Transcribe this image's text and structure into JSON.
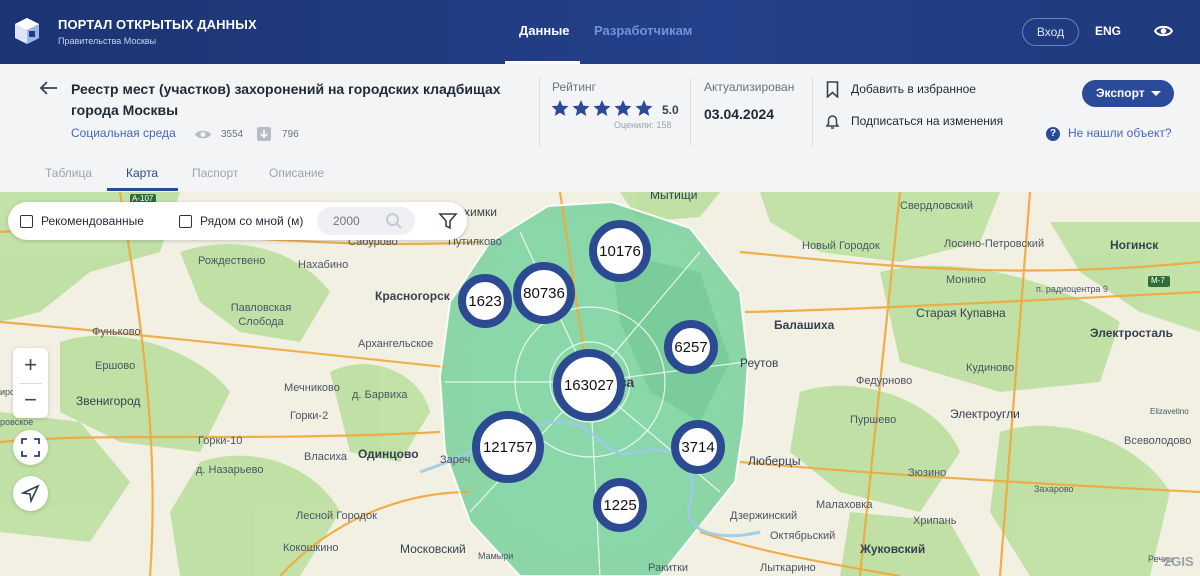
{
  "header": {
    "brand_title": "ПОРТАЛ ОТКРЫТЫХ ДАННЫХ",
    "brand_subtitle": "Правительства Москвы",
    "nav": [
      "Данные",
      "Разработчикам"
    ],
    "login": "Вход",
    "lang": "ENG",
    "accessibility_icon": "eye-icon"
  },
  "dataset": {
    "title": "Реестр мест (участков) захоронений на городских кладбищах города Москвы",
    "category": "Социальная среда",
    "views": "3554",
    "downloads": "796",
    "rating_label": "Рейтинг",
    "rating_value": "5.0",
    "rating_stars": 5,
    "rating_count": "Оценили: 158",
    "updated_label": "Актуализирован",
    "updated_value": "03.04.2024",
    "favorite": "Добавить в избранное",
    "subscribe": "Подписаться на изменения",
    "export": "Экспорт",
    "help": "Не нашли объект?",
    "tabs": [
      "Таблица",
      "Карта",
      "Паспорт",
      "Описание"
    ],
    "active_tab": "Карта"
  },
  "map": {
    "filters": {
      "recommended": "Рекомендованные",
      "nearby": "Рядом со мной (м)",
      "radius_placeholder": "2000"
    },
    "zoom_in": "+",
    "zoom_out": "−",
    "clusters": [
      "10176",
      "80736",
      "1623",
      "6257",
      "163027",
      "121757",
      "3714",
      "1225"
    ],
    "places": {
      "mytishchi": "Мытищи",
      "khimki": "химки",
      "sverdlovsky": "Свердловский",
      "novy_gorodok": "Новый Городок",
      "losino": "Лосино-Петровский",
      "noginsk": "Ногинск",
      "saburovo": "Сабурово",
      "putilkovo": "Путилково",
      "rozhdestveno": "Рождествено",
      "nakhabino": "Нахабино",
      "krasnogorsk": "Красногорск",
      "pavlovskaya": "Павловская Слобода",
      "funkovo": "Фуньково",
      "yershovo": "Ершово",
      "arkhangelskoe": "Архангельское",
      "monino": "Монино",
      "radio": "п. радиоцентра 9",
      "balashikha": "Балашиха",
      "staraya_kupavna": "Старая Купавна",
      "elektrostal": "Электросталь",
      "kudinovo": "Кудиново",
      "reutov": "Реутов",
      "fedurnovo": "Федурново",
      "zvenigorod": "Звенигород",
      "mechnikovo": "Мечниково",
      "barvikha": "д. Барвиха",
      "gorki2": "Горки-2",
      "gorki10": "Горки-10",
      "nazaryevo": "д. Назарьево",
      "odintsovo": "Одинцово",
      "vlasikha": "Власиха",
      "lyubertsy": "Люберцы",
      "pyrshovo": "Пуршево",
      "elektrougli": "Электроугли",
      "vsevolodovo": "Всеволодово",
      "zyozino": "Зюзино",
      "zakharovo": "Захарово",
      "lesnoy": "Лесной Городок",
      "malakhovka": "Малаховка",
      "khripan": "Хрипань",
      "dzerzhinsky": "Дзержинский",
      "oktyabrsky": "Октябрьский",
      "zhukovsky": "Жуковский",
      "moskovsky": "Московский",
      "kokoshkino": "Кокошкино",
      "mamyri": "Мамыри",
      "rassudovo": "Ракитки",
      "lytkarino": "Лыткарино",
      "zarech": "Зареч",
      "moskva": "ва",
      "rechitsy": "Речиц",
      "elizavetino": "Elizavetino",
      "rovskoe": "ровское",
      "irskoe": "ирское"
    },
    "road_badges": [
      "А-107",
      "М-7"
    ],
    "attribution": "2GIS",
    "colors": {
      "cluster_ring": "#2c4a92",
      "moscow_fill": "#7fd2a0",
      "forest": "#bfe0a3",
      "land": "#f2efe3",
      "roads": "#f0a83a"
    }
  }
}
